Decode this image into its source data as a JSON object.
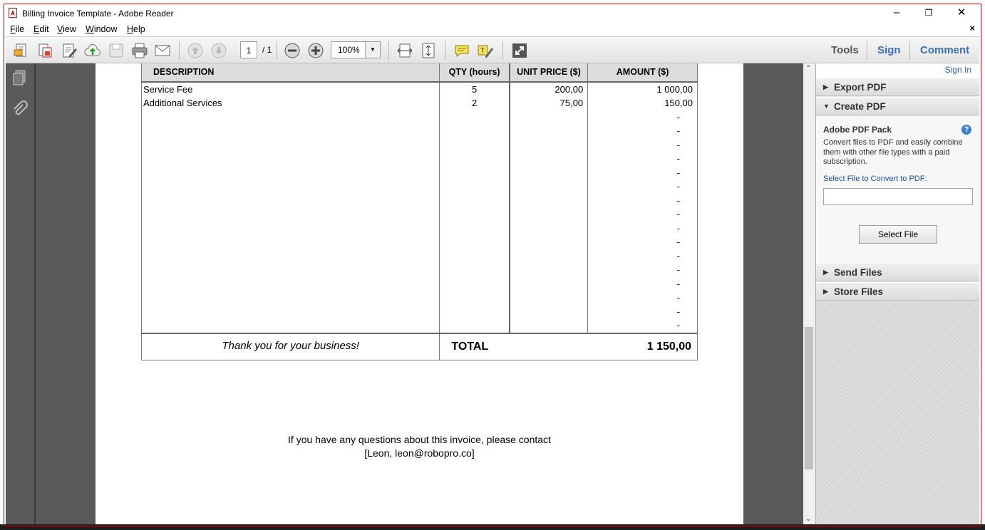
{
  "window": {
    "title": "Billing Invoice Template - Adobe Reader",
    "minimize": "–",
    "restore": "❐",
    "close": "✕"
  },
  "menu": [
    {
      "label": "File"
    },
    {
      "label": "Edit"
    },
    {
      "label": "View"
    },
    {
      "label": "Window"
    },
    {
      "label": "Help"
    }
  ],
  "doc_close": "×",
  "toolbar": {
    "page_current": "1",
    "page_total": "/ 1",
    "zoom": "100%",
    "tools": "Tools",
    "sign": "Sign",
    "comment": "Comment"
  },
  "invoice": {
    "headers": [
      "DESCRIPTION",
      "QTY (hours)",
      "UNIT PRICE ($)",
      "AMOUNT ($)"
    ],
    "rows": [
      {
        "desc": "Service Fee",
        "qty": "5",
        "price": "200,00",
        "amount": "1 000,00"
      },
      {
        "desc": "Additional Services",
        "qty": "2",
        "price": "75,00",
        "amount": "150,00"
      }
    ],
    "empty_amount": "-",
    "thanks": "Thank you for your business!",
    "total_label": "TOTAL",
    "total_value": "1 150,00",
    "contact_line1": "If you have any questions about this invoice, please contact",
    "contact_line2": "[Leon, leon@robopro.co]"
  },
  "right_pane": {
    "sign_in": "Sign In",
    "export_pdf": "Export PDF",
    "create_pdf": "Create PDF",
    "pack_title": "Adobe PDF Pack",
    "pack_desc": "Convert files to PDF and easily combine them with other file types with a paid subscription.",
    "select_label": "Select File to Convert to PDF:",
    "select_button": "Select File",
    "send_files": "Send Files",
    "store_files": "Store Files"
  }
}
